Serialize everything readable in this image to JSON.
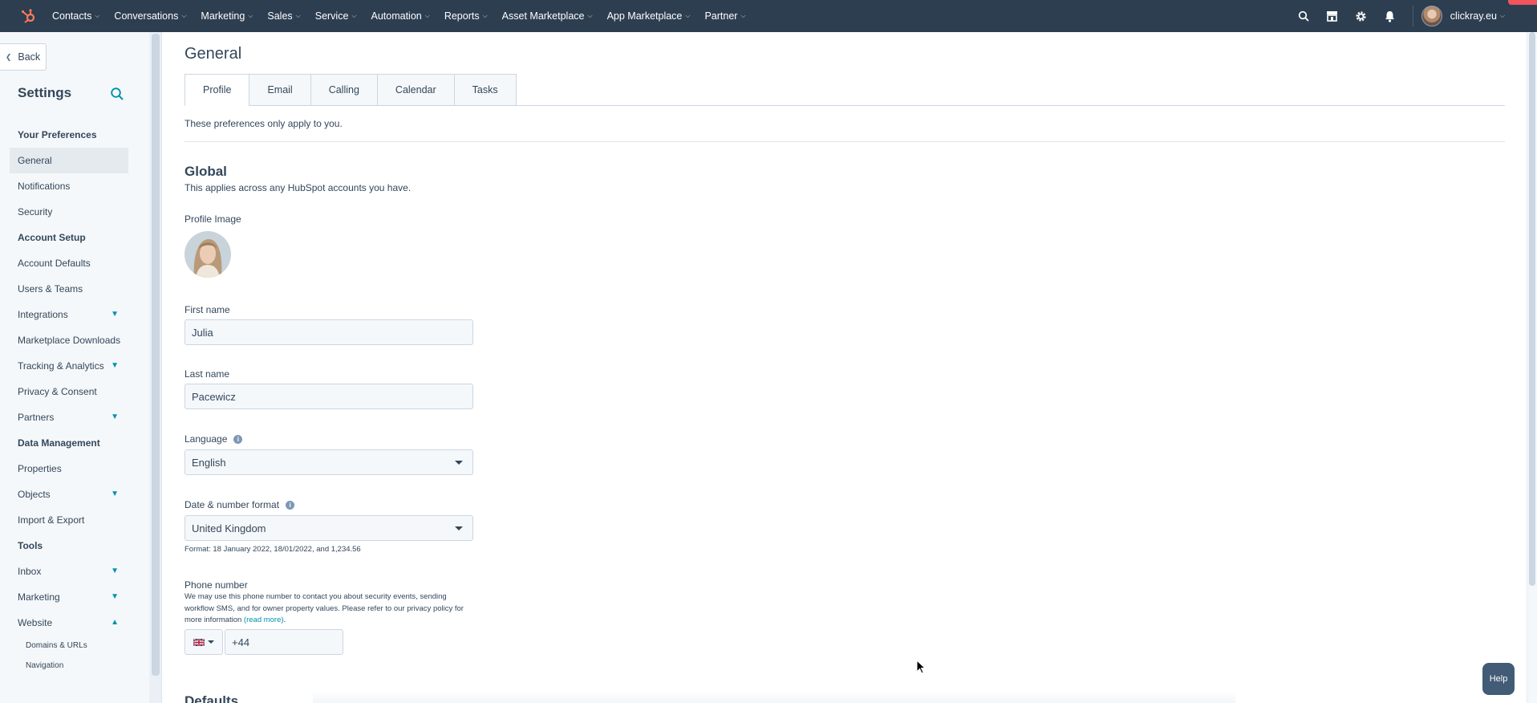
{
  "topnav": {
    "items": [
      {
        "label": "Contacts"
      },
      {
        "label": "Conversations"
      },
      {
        "label": "Marketing"
      },
      {
        "label": "Sales"
      },
      {
        "label": "Service"
      },
      {
        "label": "Automation"
      },
      {
        "label": "Reports"
      },
      {
        "label": "Asset Marketplace"
      },
      {
        "label": "App Marketplace"
      },
      {
        "label": "Partner"
      }
    ],
    "account_name": "clickray.eu",
    "icons": [
      "search-icon",
      "marketplace-icon",
      "gear-icon",
      "bell-icon"
    ]
  },
  "sidebar": {
    "back_label": "Back",
    "title": "Settings",
    "sections": [
      {
        "title": "Your Preferences",
        "items": [
          "General",
          "Notifications",
          "Security"
        ]
      },
      {
        "title": "Account Setup",
        "items": [
          "Account Defaults",
          "Users & Teams",
          "Integrations",
          "Marketplace Downloads",
          "Tracking & Analytics",
          "Privacy & Consent",
          "Partners"
        ]
      },
      {
        "title": "Data Management",
        "items": [
          "Properties",
          "Objects",
          "Import & Export"
        ]
      },
      {
        "title": "Tools",
        "items": [
          "Inbox",
          "Marketing",
          "Website"
        ]
      }
    ],
    "sub_items": [
      "Domains & URLs",
      "Navigation"
    ]
  },
  "main": {
    "title": "General",
    "tabs": [
      "Profile",
      "Email",
      "Calling",
      "Calendar",
      "Tasks"
    ],
    "active_tab": "Profile",
    "note": "These preferences only apply to you.",
    "global_title": "Global",
    "global_sub": "This applies across any HubSpot accounts you have.",
    "profile_image_label": "Profile Image",
    "first_name_label": "First name",
    "first_name_value": "Julia",
    "last_name_label": "Last name",
    "last_name_value": "Pacewicz",
    "language_label": "Language",
    "language_value": "English",
    "date_format_label": "Date & number format",
    "date_format_value": "United Kingdom",
    "format_hint": "Format: 18 January 2022, 18/01/2022, and 1,234.56",
    "phone_label": "Phone number",
    "phone_desc": "We may use this phone number to contact you about security events, sending workflow SMS, and for owner property values. Please refer to our privacy policy for more information ",
    "phone_read_more": "(read more)",
    "phone_desc_end": ".",
    "phone_value": "+44",
    "defaults_title": "Defaults"
  },
  "help_label": "Help",
  "colors": {
    "nav_bg": "#2d3e50",
    "accent": "#0091ae",
    "text": "#33475b",
    "hubspot_orange": "#ff7a59"
  }
}
